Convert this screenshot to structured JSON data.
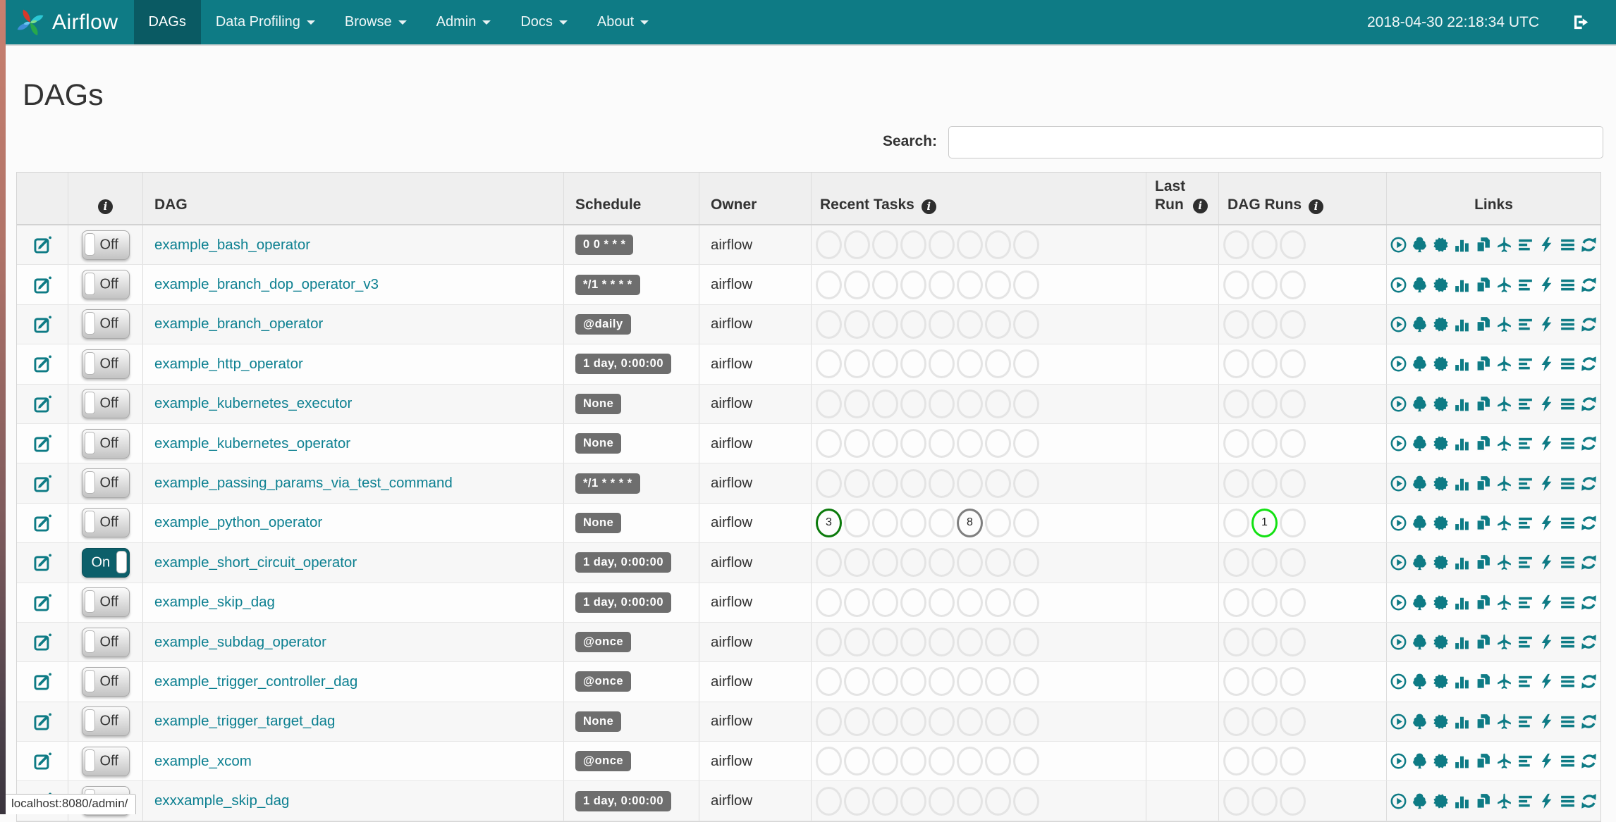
{
  "navbar": {
    "brand": "Airflow",
    "items": [
      {
        "id": "dags",
        "label": "DAGs",
        "caret": false,
        "active": true
      },
      {
        "id": "data-profiling",
        "label": "Data Profiling",
        "caret": true,
        "active": false
      },
      {
        "id": "browse",
        "label": "Browse",
        "caret": true,
        "active": false
      },
      {
        "id": "admin",
        "label": "Admin",
        "caret": true,
        "active": false
      },
      {
        "id": "docs",
        "label": "Docs",
        "caret": true,
        "active": false
      },
      {
        "id": "about",
        "label": "About",
        "caret": true,
        "active": false
      }
    ],
    "datetime": "2018-04-30 22:18:34 UTC",
    "logout_icon": "sign-out"
  },
  "page": {
    "title": "DAGs"
  },
  "search": {
    "label": "Search:",
    "value": "",
    "placeholder": ""
  },
  "table": {
    "headers": {
      "info_icon": "i",
      "dag": "DAG",
      "schedule": "Schedule",
      "owner": "Owner",
      "recent_tasks": "Recent Tasks",
      "last_run": "Last Run",
      "dag_runs": "DAG Runs",
      "links": "Links"
    },
    "recent_task_slots": 8,
    "dag_run_slots": 3,
    "links": [
      {
        "name": "trigger-dag",
        "icon": "play-circle"
      },
      {
        "name": "tree-view",
        "icon": "tree"
      },
      {
        "name": "graph-view",
        "icon": "certificate"
      },
      {
        "name": "task-duration",
        "icon": "bar-chart"
      },
      {
        "name": "task-tries",
        "icon": "duplicate"
      },
      {
        "name": "landing-times",
        "icon": "plane"
      },
      {
        "name": "gantt-view",
        "icon": "align-left"
      },
      {
        "name": "code-view",
        "icon": "bolt"
      },
      {
        "name": "logs",
        "icon": "align-justify"
      },
      {
        "name": "refresh",
        "icon": "refresh"
      }
    ],
    "rows": [
      {
        "dag_id": "example_bash_operator",
        "toggle": "Off",
        "schedule": "0 0 * * *",
        "owner": "airflow",
        "recent_tasks": [],
        "dag_runs": []
      },
      {
        "dag_id": "example_branch_dop_operator_v3",
        "toggle": "Off",
        "schedule": "*/1 * * * *",
        "owner": "airflow",
        "recent_tasks": [],
        "dag_runs": []
      },
      {
        "dag_id": "example_branch_operator",
        "toggle": "Off",
        "schedule": "@daily",
        "owner": "airflow",
        "recent_tasks": [],
        "dag_runs": []
      },
      {
        "dag_id": "example_http_operator",
        "toggle": "Off",
        "schedule": "1 day, 0:00:00",
        "owner": "airflow",
        "recent_tasks": [],
        "dag_runs": []
      },
      {
        "dag_id": "example_kubernetes_executor",
        "toggle": "Off",
        "schedule": "None",
        "owner": "airflow",
        "recent_tasks": [],
        "dag_runs": []
      },
      {
        "dag_id": "example_kubernetes_operator",
        "toggle": "Off",
        "schedule": "None",
        "owner": "airflow",
        "recent_tasks": [],
        "dag_runs": []
      },
      {
        "dag_id": "example_passing_params_via_test_command",
        "toggle": "Off",
        "schedule": "*/1 * * * *",
        "owner": "airflow",
        "recent_tasks": [],
        "dag_runs": []
      },
      {
        "dag_id": "example_python_operator",
        "toggle": "Off",
        "schedule": "None",
        "owner": "airflow",
        "recent_tasks": [
          {
            "pos": 1,
            "count": "3",
            "state": "success",
            "color": "#0b7a0b"
          },
          {
            "pos": 6,
            "count": "8",
            "state": "queued",
            "color": "#7f7f7f"
          }
        ],
        "dag_runs": [
          {
            "pos": 2,
            "count": "1",
            "state": "running",
            "color": "#12e112"
          }
        ]
      },
      {
        "dag_id": "example_short_circuit_operator",
        "toggle": "On",
        "schedule": "1 day, 0:00:00",
        "owner": "airflow",
        "recent_tasks": [],
        "dag_runs": []
      },
      {
        "dag_id": "example_skip_dag",
        "toggle": "Off",
        "schedule": "1 day, 0:00:00",
        "owner": "airflow",
        "recent_tasks": [],
        "dag_runs": []
      },
      {
        "dag_id": "example_subdag_operator",
        "toggle": "Off",
        "schedule": "@once",
        "owner": "airflow",
        "recent_tasks": [],
        "dag_runs": []
      },
      {
        "dag_id": "example_trigger_controller_dag",
        "toggle": "Off",
        "schedule": "@once",
        "owner": "airflow",
        "recent_tasks": [],
        "dag_runs": []
      },
      {
        "dag_id": "example_trigger_target_dag",
        "toggle": "Off",
        "schedule": "None",
        "owner": "airflow",
        "recent_tasks": [],
        "dag_runs": []
      },
      {
        "dag_id": "example_xcom",
        "toggle": "Off",
        "schedule": "@once",
        "owner": "airflow",
        "recent_tasks": [],
        "dag_runs": []
      },
      {
        "dag_id": "exxxample_skip_dag",
        "toggle": "Off",
        "schedule": "1 day, 0:00:00",
        "owner": "airflow",
        "recent_tasks": [],
        "dag_runs": []
      }
    ]
  },
  "statusbar": {
    "text": "localhost:8080/admin/"
  },
  "colors": {
    "navbar": "#0e7b85",
    "navbar_active": "#0a5a63",
    "link": "#0d8091",
    "badge_bg": "#6e6e6e",
    "success": "#0b7a0b",
    "queued": "#7f7f7f",
    "running": "#12e112"
  }
}
